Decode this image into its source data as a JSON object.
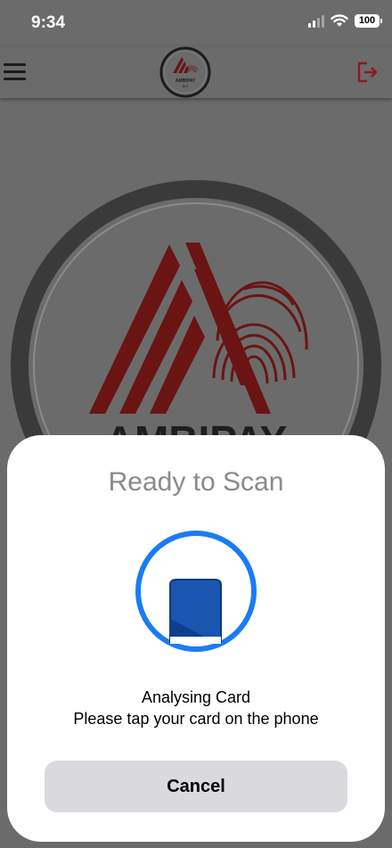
{
  "status_bar": {
    "time": "9:34",
    "battery_level": "100",
    "signal_bars_active": 2,
    "signal_bars_total": 4
  },
  "header": {
    "logo_text_line1": "AMBIPAY",
    "logo_text_line2": "BIO",
    "menu_icon": "hamburger-menu-icon",
    "logout_icon": "logout-icon",
    "accent_color": "#8b1a1a"
  },
  "background": {
    "logo_wordmark": "AMBIPAY"
  },
  "scan_sheet": {
    "title": "Ready to Scan",
    "message_line1": "Analysing Card",
    "message_line2": "Please tap your card on the phone",
    "cancel_label": "Cancel",
    "ring_color": "#1a7cf5",
    "phone_icon": "phone-icon"
  }
}
